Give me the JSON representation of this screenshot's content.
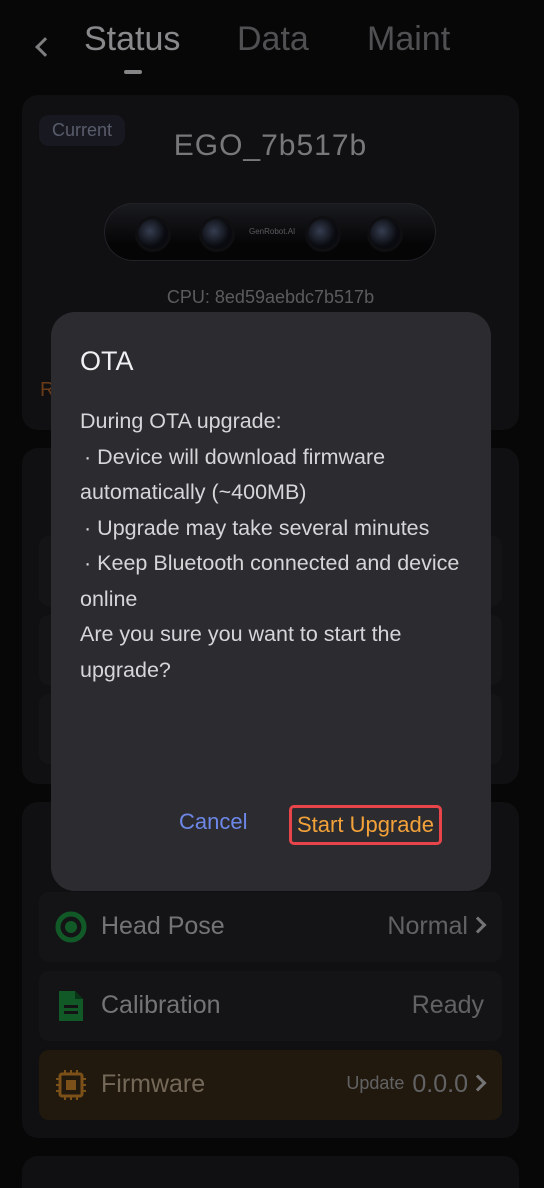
{
  "tabs": [
    {
      "label": "Status"
    },
    {
      "label": "Data"
    },
    {
      "label": "Maint"
    }
  ],
  "device": {
    "badge": "Current",
    "name": "EGO_7b517b",
    "camera_logo": "GenRobot.AI",
    "cpu": "CPU: 8ed59aebdc7b517b",
    "peek_text": "R"
  },
  "status_rows": [
    {
      "label": "Head Pose",
      "value": "Normal",
      "icon": "head-pose-icon"
    },
    {
      "label": "Calibration",
      "value": "Ready",
      "icon": "calibration-document-icon"
    },
    {
      "label": "Firmware",
      "value": "0.0.0",
      "badge": "Update",
      "icon": "chip-icon"
    }
  ],
  "dialog": {
    "title": "OTA",
    "intro": "During OTA upgrade:",
    "bullet_symbol": "·",
    "bullets": [
      "Device will download firmware automatically (~400MB)",
      "Upgrade may take several minutes",
      "Keep Bluetooth connected and device online"
    ],
    "question": "Are you sure you want to start the upgrade?",
    "cancel_label": "Cancel",
    "confirm_label": "Start Upgrade"
  },
  "colors": {
    "background": "#0d0d0e",
    "card": "#1c1c1f",
    "dialog": "#2c2c30",
    "cancel": "#6d87e8",
    "confirm": "#f3a23a",
    "highlight_border": "#e8454b",
    "firmware_row": "#3a2b17",
    "icon_green": "#1f9a45"
  }
}
